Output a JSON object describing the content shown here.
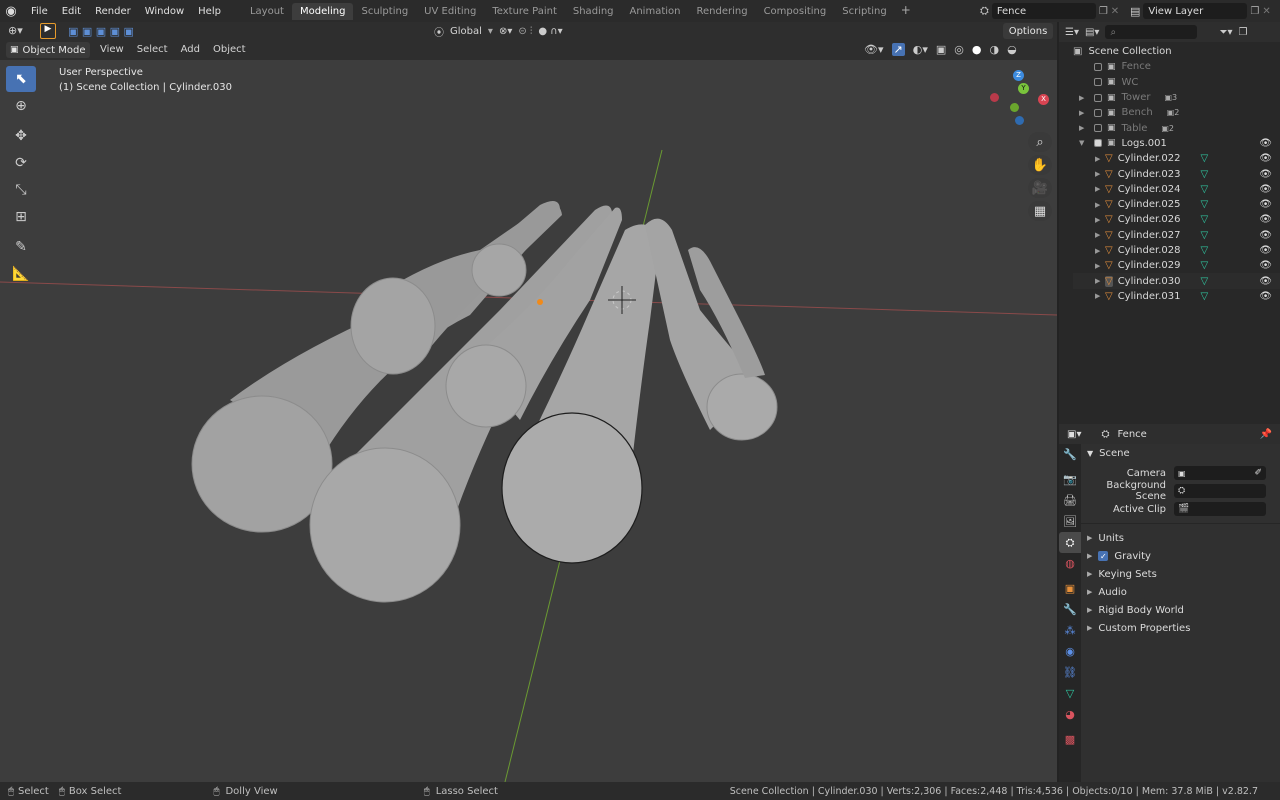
{
  "topbar": {
    "menus": [
      "File",
      "Edit",
      "Render",
      "Window",
      "Help"
    ],
    "workspaces": [
      "Layout",
      "Modeling",
      "Sculpting",
      "UV Editing",
      "Texture Paint",
      "Shading",
      "Animation",
      "Rendering",
      "Compositing",
      "Scripting"
    ],
    "active_workspace": "Modeling",
    "scene_name": "Fence",
    "view_layer": "View Layer"
  },
  "header": {
    "mode": "Object Mode",
    "menus": [
      "View",
      "Select",
      "Add",
      "Object"
    ],
    "orientation": "Global",
    "options": "Options"
  },
  "viewport": {
    "title": "User Perspective",
    "subtitle": "(1) Scene Collection | Cylinder.030",
    "gizmo_axes": {
      "z": "Z",
      "y": "Y",
      "x": "X"
    }
  },
  "outliner": {
    "root": "Scene Collection",
    "collections": [
      {
        "name": "Fence",
        "dim": true
      },
      {
        "name": "WC",
        "dim": true
      },
      {
        "name": "Tower",
        "dim": true,
        "badge": "3"
      },
      {
        "name": "Bench",
        "dim": true,
        "badge": "2"
      },
      {
        "name": "Table",
        "dim": true,
        "badge": "2"
      },
      {
        "name": "Logs.001",
        "dim": false
      }
    ],
    "objects": [
      "Cylinder.022",
      "Cylinder.023",
      "Cylinder.024",
      "Cylinder.025",
      "Cylinder.026",
      "Cylinder.027",
      "Cylinder.028",
      "Cylinder.029",
      "Cylinder.030",
      "Cylinder.031"
    ],
    "selected": "Cylinder.030"
  },
  "properties": {
    "context": "Fence",
    "section": "Scene",
    "camera_label": "Camera",
    "bg_scene_label": "Background Scene",
    "active_clip_label": "Active Clip",
    "panels": [
      "Units",
      "Gravity",
      "Keying Sets",
      "Audio",
      "Rigid Body World",
      "Custom Properties"
    ]
  },
  "statusbar": {
    "select": "Select",
    "box_select": "Box Select",
    "dolly": "Dolly View",
    "lasso": "Lasso Select",
    "stats": "Scene Collection | Cylinder.030 | Verts:2,306 | Faces:2,448 | Tris:4,536 | Objects:0/10 | Mem: 37.8 MiB | v2.82.7"
  },
  "colors": {
    "accent": "#4772b3",
    "mesh_icon": "#e08d3c",
    "data_icon": "#2fc7a1",
    "x_axis": "#d94452",
    "y_axis": "#7ac43c",
    "z_axis": "#3d8ce0"
  }
}
